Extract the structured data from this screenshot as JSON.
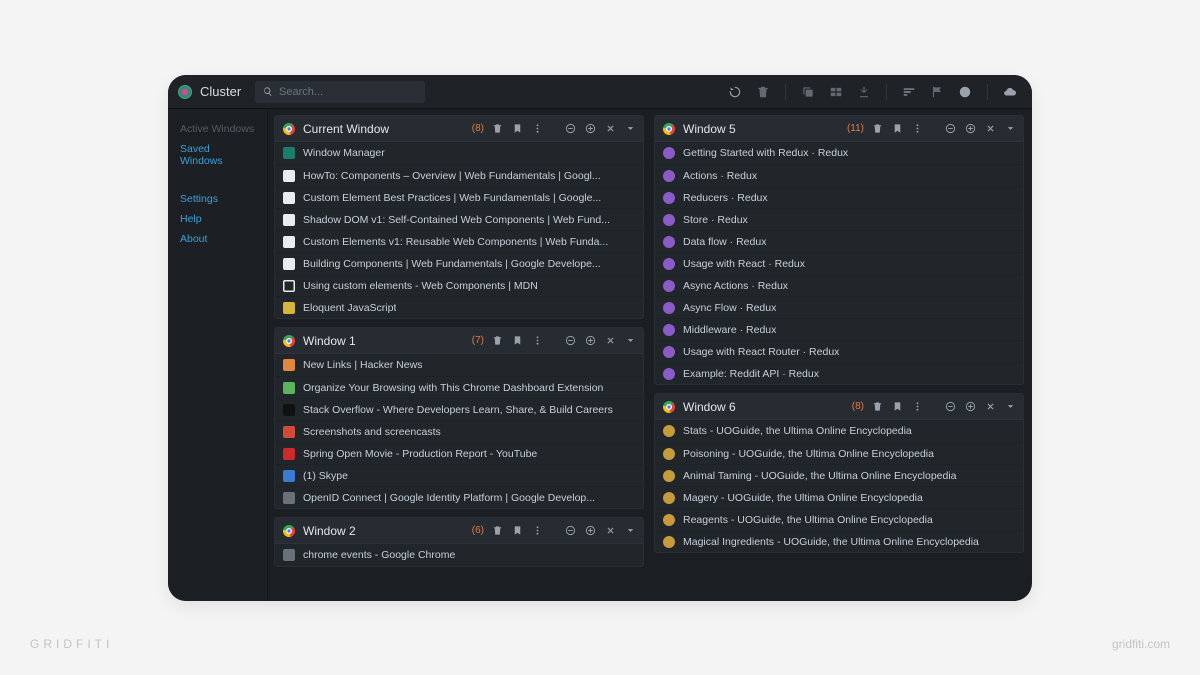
{
  "branding": {
    "watermark_left": "GRIDFITI",
    "watermark_right": "gridfiti.com"
  },
  "app": {
    "title": "Cluster"
  },
  "search": {
    "placeholder": "Search..."
  },
  "sidebar": {
    "active_label": "Active Windows",
    "saved_label": "Saved Windows",
    "settings": "Settings",
    "help": "Help",
    "about": "About"
  },
  "columns": [
    {
      "panels": [
        {
          "title": "Current Window",
          "count": "(8)",
          "tabs": [
            {
              "fav": "fv-teal",
              "title": "Window Manager"
            },
            {
              "fav": "fv-white",
              "title": "HowTo: Components – Overview | Web Fundamentals | Googl..."
            },
            {
              "fav": "fv-white",
              "title": "Custom Element Best Practices | Web Fundamentals | Google..."
            },
            {
              "fav": "fv-white",
              "title": "Shadow DOM v1: Self-Contained Web Components | Web Fund..."
            },
            {
              "fav": "fv-white",
              "title": "Custom Elements v1: Reusable Web Components | Web Funda..."
            },
            {
              "fav": "fv-white",
              "title": "Building Components | Web Fundamentals | Google Develope..."
            },
            {
              "fav": "fv-outline",
              "title": "Using custom elements - Web Components | MDN"
            },
            {
              "fav": "fv-yellow",
              "title": "Eloquent JavaScript"
            }
          ]
        },
        {
          "title": "Window 1",
          "count": "(7)",
          "tabs": [
            {
              "fav": "fv-orange",
              "title": "New Links | Hacker News"
            },
            {
              "fav": "fv-green",
              "title": "Organize Your Browsing with This Chrome Dashboard Extension"
            },
            {
              "fav": "fv-black",
              "title": "Stack Overflow - Where Developers Learn, Share, & Build Careers"
            },
            {
              "fav": "fv-red",
              "title": "Screenshots and screencasts"
            },
            {
              "fav": "fv-redsq",
              "title": "Spring Open Movie - Production Report - YouTube"
            },
            {
              "fav": "fv-blue",
              "title": "(1) Skype"
            },
            {
              "fav": "fv-grey",
              "title": "OpenID Connect | Google Identity Platform | Google Develop..."
            }
          ]
        },
        {
          "title": "Window 2",
          "count": "(6)",
          "tabs": [
            {
              "fav": "fv-grey",
              "title": "chrome events - Google Chrome"
            }
          ]
        }
      ]
    },
    {
      "panels": [
        {
          "title": "Window 5",
          "count": "(11)",
          "tabs": [
            {
              "fav": "fv-purple",
              "title": "Getting Started with Redux · Redux"
            },
            {
              "fav": "fv-purple",
              "title": "Actions · Redux"
            },
            {
              "fav": "fv-purple",
              "title": "Reducers · Redux"
            },
            {
              "fav": "fv-purple",
              "title": "Store · Redux"
            },
            {
              "fav": "fv-purple",
              "title": "Data flow · Redux"
            },
            {
              "fav": "fv-purple",
              "title": "Usage with React · Redux"
            },
            {
              "fav": "fv-purple",
              "title": "Async Actions · Redux"
            },
            {
              "fav": "fv-purple",
              "title": "Async Flow · Redux"
            },
            {
              "fav": "fv-purple",
              "title": "Middleware · Redux"
            },
            {
              "fav": "fv-purple",
              "title": "Usage with React Router · Redux"
            },
            {
              "fav": "fv-purple",
              "title": "Example: Reddit API · Redux"
            }
          ]
        },
        {
          "title": "Window 6",
          "count": "(8)",
          "tabs": [
            {
              "fav": "fv-amber",
              "title": "Stats - UOGuide, the Ultima Online Encyclopedia"
            },
            {
              "fav": "fv-amber",
              "title": "Poisoning - UOGuide, the Ultima Online Encyclopedia"
            },
            {
              "fav": "fv-amber",
              "title": "Animal Taming - UOGuide, the Ultima Online Encyclopedia"
            },
            {
              "fav": "fv-amber",
              "title": "Magery - UOGuide, the Ultima Online Encyclopedia"
            },
            {
              "fav": "fv-amber",
              "title": "Reagents - UOGuide, the Ultima Online Encyclopedia"
            },
            {
              "fav": "fv-amber",
              "title": "Magical Ingredients - UOGuide, the Ultima Online Encyclopedia"
            }
          ]
        }
      ]
    }
  ]
}
